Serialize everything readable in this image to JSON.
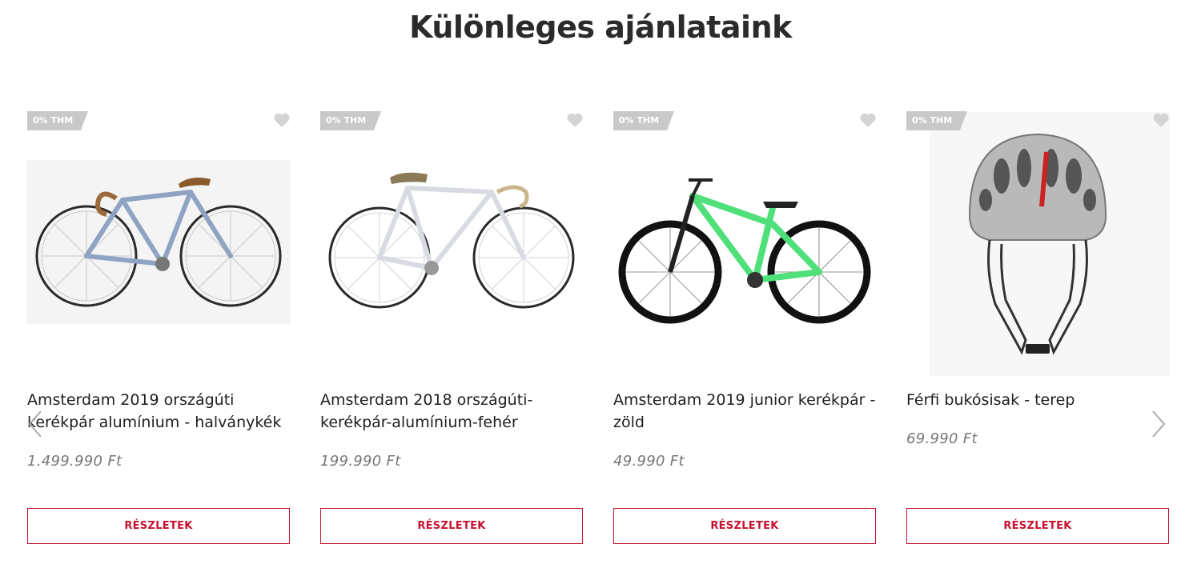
{
  "section": {
    "title": "Különleges ajánlataink"
  },
  "products": [
    {
      "badge": "0% THM",
      "name": "Amsterdam 2019 országúti kerékpár alumínium - halványkék",
      "price": "1.499.990 Ft",
      "button": "RÉSZLETEK",
      "frame_color": "#8fa3c2"
    },
    {
      "badge": "0% THM",
      "name": "Amsterdam 2018 országúti-kerékpár-alumínium-fehér",
      "price": "199.990 Ft",
      "button": "RÉSZLETEK",
      "frame_color": "#d9dbe3"
    },
    {
      "badge": "0% THM",
      "name": "Amsterdam 2019 junior kerékpár - zöld",
      "price": "49.990 Ft",
      "button": "RÉSZLETEK",
      "frame_color": "#4fe07a"
    },
    {
      "badge": "0% THM",
      "name": "Férfi bukósisak - terep",
      "price": "69.990 Ft",
      "button": "RÉSZLETEK",
      "helmet_color": "#b9b9b9"
    }
  ],
  "colors": {
    "accent": "#c8102e",
    "badge_bg": "#c9c9c9",
    "icon_grey": "#d4d4d4"
  },
  "icons": {
    "wishlist": "heart-icon",
    "prev": "chevron-left-icon",
    "next": "chevron-right-icon"
  }
}
